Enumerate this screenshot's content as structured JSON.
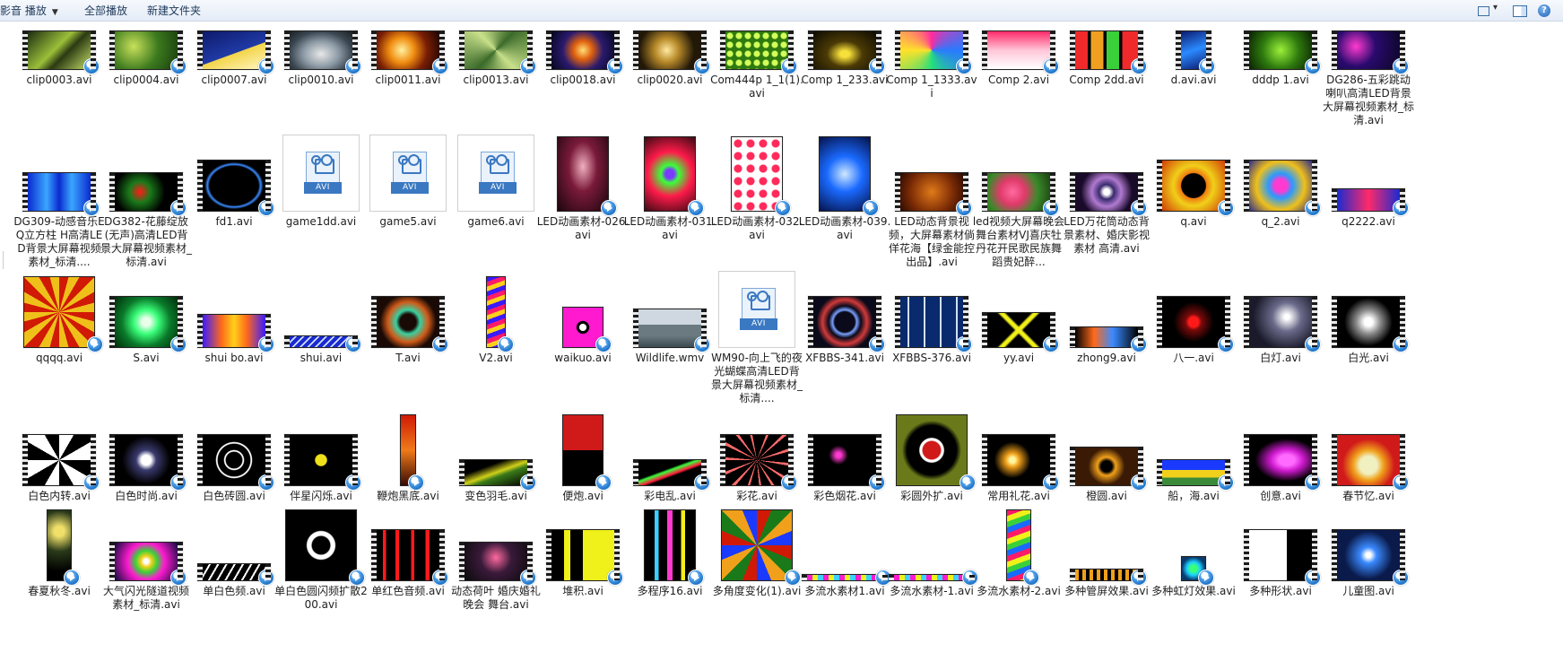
{
  "toolbar": {
    "play_label": "影音 播放",
    "play_all_label": "全部播放",
    "new_folder_label": "新建文件夹",
    "help_glyph": "?"
  },
  "colors": {
    "toolbar_text": "#1e395b",
    "badge": "#1e74c9"
  },
  "files": [
    {
      "name": "clip0003.avi",
      "kind": "film",
      "w": 70,
      "h": 44,
      "bg": "linear-gradient(135deg,#1a2a10,#9bbf3a 45%,#2b3a12 60%,#c7e06a)"
    },
    {
      "name": "clip0004.avi",
      "kind": "film",
      "w": 70,
      "h": 44,
      "bg": "radial-gradient(circle at 30% 40%,#c8e05a,#3c7a1e 50%,#183c0e)"
    },
    {
      "name": "clip0007.avi",
      "kind": "film",
      "w": 70,
      "h": 44,
      "bg": "linear-gradient(160deg,#0d1a6b,#203aa6 55%,#f3d54a 56%,#fff6c4)"
    },
    {
      "name": "clip0010.avi",
      "kind": "film",
      "w": 70,
      "h": 44,
      "bg": "radial-gradient(ellipse at 50% 60%,#e8e8e8,#8c9aa5 40%,#3a4650 70%,#1c1f22)"
    },
    {
      "name": "clip0011.avi",
      "kind": "film",
      "w": 70,
      "h": 44,
      "bg": "radial-gradient(circle at 40% 50%,#fff2a0,#f08c10 30%,#7a1e05 60%,#160400)"
    },
    {
      "name": "clip0013.avi",
      "kind": "film",
      "w": 70,
      "h": 44,
      "bg": "conic-gradient(from 45deg,#3b6a2a,#c8e08a,#3b6a2a,#c8e08a,#3b6a2a)"
    },
    {
      "name": "clip0018.avi",
      "kind": "film",
      "w": 70,
      "h": 44,
      "bg": "radial-gradient(circle at 50% 50%,#ffe07a,#e2620e 25%,#2a1a6e 55%,#05061c)"
    },
    {
      "name": "clip0020.avi",
      "kind": "film",
      "w": 70,
      "h": 44,
      "bg": "radial-gradient(circle at 45% 50%,#ffe9a0,#b88a2a 30%,#221808 70%)"
    },
    {
      "name": "Com444p 1_1(1).avi",
      "kind": "film",
      "w": 70,
      "h": 44,
      "bg": "radial-gradient(circle,#d4ff5a 0 3px,#2e7a0e 4px) 0 0/10px 10px"
    },
    {
      "name": "Comp 1_233.avi",
      "kind": "film",
      "w": 70,
      "h": 44,
      "bg": "radial-gradient(ellipse at 50% 60%,#f7e03a 0 10%,#4b3a05 40%,#0c0a02)"
    },
    {
      "name": "Comp 1_1333.avi",
      "kind": "film",
      "w": 70,
      "h": 44,
      "bg": "conic-gradient(#ff2aa0,#2a7aff,#24e07a,#ffe12a,#ff2aa0)"
    },
    {
      "name": "Comp 2.avi",
      "kind": "film",
      "w": 70,
      "h": 44,
      "bg": "linear-gradient(#ff2a6a,#ffc6d8 50%,#fff)"
    },
    {
      "name": "Comp 2dd.avi",
      "kind": "film",
      "w": 70,
      "h": 44,
      "bg": "linear-gradient(90deg,#f02a2a 0 20%,#000 20% 25%,#f0a020 25% 45%,#000 45% 50%,#39d03a 50% 70%,#000 70% 75%,#f02a2a 75%)"
    },
    {
      "name": "d.avi.avi",
      "kind": "film",
      "w": 28,
      "h": 44,
      "bg": "linear-gradient(160deg,#0b1a6e,#2a8aff 50%,#0b1a6e)"
    },
    {
      "name": "dddp 1.avi",
      "kind": "film",
      "w": 70,
      "h": 44,
      "bg": "radial-gradient(circle,#9cf03a,#2e7a0e 50%,#0a1f03)"
    },
    {
      "name": "DG286-五彩跳动喇叭高清LED背景大屏幕视频素材_标清.avi",
      "kind": "film",
      "w": 70,
      "h": 44,
      "bg": "radial-gradient(circle at 30% 40%,#ff3ad0,#2a0a6e 40%,#0a0622)"
    },
    {
      "name": "DG309-动感音乐EQ立方柱 H高清LED背景大屏幕视频素材_标清....",
      "kind": "film",
      "w": 70,
      "h": 44,
      "bg": "linear-gradient(90deg,#0a2ad0,#3aa6ff 30%,#0a2ad0 50%,#3aa6ff 70%,#0a2ad0)"
    },
    {
      "name": "DG382-花藤绽放(无声)高清LED背景大屏幕视频素材_标清.avi",
      "kind": "film",
      "w": 70,
      "h": 44,
      "bg": "radial-gradient(circle at 40% 50%,#ff1a1a,#1a7a1a 25%,#000 60%)"
    },
    {
      "name": "fd1.avi",
      "kind": "film",
      "w": 70,
      "h": 58,
      "bg": "radial-gradient(ellipse at 50% 50%,#000 55%,#3a8aff 60%,#000 66%)"
    },
    {
      "name": "game1dd.avi",
      "kind": "doc"
    },
    {
      "name": "game5.avi",
      "kind": "doc"
    },
    {
      "name": "game6.avi",
      "kind": "doc"
    },
    {
      "name": "LED动画素材-026.avi",
      "kind": "plain",
      "w": 58,
      "h": 84,
      "bg": "radial-gradient(ellipse at 50% 40%,#f0b0c0,#7a1a3a 40%,#1a050c)"
    },
    {
      "name": "LED动画素材-031.avi",
      "kind": "plain",
      "w": 58,
      "h": 84,
      "bg": "radial-gradient(circle,#7a3aff 0 10%,#3aff3a 20%,#ff1a4a 50%,#3a0a12)"
    },
    {
      "name": "LED动画素材-032.avi",
      "kind": "plain",
      "w": 58,
      "h": 84,
      "bg": "radial-gradient(circle,#ff2a5a 0 4px,#fff 5px) 0 0/14px 14px"
    },
    {
      "name": "LED动画素材-039.avi",
      "kind": "plain",
      "w": 58,
      "h": 84,
      "bg": "radial-gradient(circle at 50% 50%,#cfe8ff,#1a6aff 40%,#05124a)"
    },
    {
      "name": "LED动态背景视频，大屏幕素材倘佯花海【绿金能控出品】.avi",
      "kind": "film",
      "w": 70,
      "h": 44,
      "bg": "radial-gradient(circle,#e07a1a,#7a2a05 60%,#2a0a02)"
    },
    {
      "name": "led视频大屏幕晚会舞台素材VJ喜庆牡丹花开民歌民族舞蹈贵妃醉...",
      "kind": "film",
      "w": 70,
      "h": 44,
      "bg": "radial-gradient(circle at 40% 50%,#ff6aa0,#e03a6a 30%,#3a8a2a 60%,#1a3a10)"
    },
    {
      "name": "LED万花筒动态背景素材、婚庆影视素材 高清.avi",
      "kind": "film",
      "w": 70,
      "h": 44,
      "bg": "radial-gradient(circle,#fff 0 8%,#3a2a6e 20%,#b07ad0 40%,#1a0a2a 70%)"
    },
    {
      "name": "q.avi",
      "kind": "film",
      "w": 70,
      "h": 58,
      "bg": "radial-gradient(circle,#000 0 30%,#f07a10 32%,#f0d01a 50%,#d03a05)"
    },
    {
      "name": "q_2.avi",
      "kind": "film",
      "w": 70,
      "h": 58,
      "bg": "radial-gradient(circle,#ff3ad0 0 15%,#2a9aff 30%,#f0c01a 60%,#2a2a8a)"
    },
    {
      "name": "q2222.avi",
      "kind": "film",
      "w": 70,
      "h": 26,
      "bg": "linear-gradient(90deg,#1a2ad0,#ff2a6a 50%,#1a2ad0)"
    },
    {
      "name": "qqqq.avi",
      "kind": "plain",
      "w": 80,
      "h": 80,
      "bg": "repeating-conic-gradient(from 0deg,#d01a05 0 15deg,#f0c01a 15deg 30deg)"
    },
    {
      "name": "S.avi",
      "kind": "film",
      "w": 70,
      "h": 58,
      "bg": "radial-gradient(circle,#eaffea 0 10%,#3aff7a 30%,#0a7a2a 60%,#022a0a)"
    },
    {
      "name": "shui bo.avi",
      "kind": "film",
      "w": 70,
      "h": 38,
      "bg": "linear-gradient(90deg,#3a1aff,#ff6a1a 30%,#ffd01a 50%,#ff6a1a 70%,#3a1aff)"
    },
    {
      "name": "shui.avi",
      "kind": "film",
      "w": 70,
      "h": 14,
      "bg": "repeating-linear-gradient(135deg,#1a2ad0 0 4px,#cfe0ff 4px 6px)"
    },
    {
      "name": "T.avi",
      "kind": "film",
      "w": 70,
      "h": 58,
      "bg": "radial-gradient(circle,#1a0a05 0 20%,#3ad0a0 30%,#d05a1a 50%,#1a0a05 70%)"
    },
    {
      "name": "V2.avi",
      "kind": "plain",
      "w": 22,
      "h": 80,
      "bg": "repeating-linear-gradient(160deg,#3a1aff 0 5px,#ff1a6a 5px 10px,#ffd01a 10px 15px)"
    },
    {
      "name": "waikuo.avi",
      "kind": "plain",
      "w": 46,
      "h": 46,
      "bg": "radial-gradient(circle,#fff 0 12%,#000 14% 22%,#ff1ad0 24%)"
    },
    {
      "name": "Wildlife.wmv",
      "kind": "film",
      "w": 70,
      "h": 44,
      "bg": "linear-gradient(#cfd8e0 0 40%,#6a7a80 40% 70%,#3a4a50)"
    },
    {
      "name": "WM90-向上飞的夜光蝴蝶高清LED背景大屏幕视频素材_标清....",
      "kind": "doc"
    },
    {
      "name": "XFBBS-341.avi",
      "kind": "film",
      "w": 70,
      "h": 58,
      "bg": "radial-gradient(circle,#0a0a1a 0 25%,#7aa0ff 30%,#0a0a1a 40%,#d03a3a 55%,#0a0a1a 70%)"
    },
    {
      "name": "XFBBS-376.avi",
      "kind": "film",
      "w": 70,
      "h": 58,
      "bg": "repeating-linear-gradient(90deg,#0a2a6e 0 8px,#cfe0ff 8px 10px,#0a2a6e 10px 18px)"
    },
    {
      "name": "yy.avi",
      "kind": "film",
      "w": 70,
      "h": 40,
      "bg": "linear-gradient(45deg,transparent 45%,#f0f01a 48%,#f0f01a 52%,transparent 55%),linear-gradient(-45deg,#000 45%,#f0f01a 48%,#f0f01a 52%,#000 55%)"
    },
    {
      "name": "zhong9.avi",
      "kind": "film",
      "w": 70,
      "h": 24,
      "bg": "linear-gradient(90deg,#000,#ff6a1a 30%,#3a8aff 60%,#000)"
    },
    {
      "name": "八一.avi",
      "kind": "film",
      "w": 70,
      "h": 58,
      "bg": "radial-gradient(circle,#ff1a1a 0 12%,#7a0a0a 20%,#000 50%)"
    },
    {
      "name": "白灯.avi",
      "kind": "film",
      "w": 70,
      "h": 58,
      "bg": "radial-gradient(circle at 60% 40%,#fff 0 5%,#6a6a8a 30%,#1a1a2a 70%)"
    },
    {
      "name": "白光.avi",
      "kind": "film",
      "w": 70,
      "h": 58,
      "bg": "radial-gradient(circle,#fff 0 10%,#8a8a8a 30%,#000 60%)"
    },
    {
      "name": "白色内转.avi",
      "kind": "film",
      "w": 70,
      "h": 58,
      "bg": "repeating-conic-gradient(#fff 0 30deg,#000 30deg 60deg)"
    },
    {
      "name": "白色时尚.avi",
      "kind": "film",
      "w": 70,
      "h": 58,
      "bg": "radial-gradient(circle,#fff 0 12%,#3a3a6e 25%,#000 60%)"
    },
    {
      "name": "白色砖圆.avi",
      "kind": "film",
      "w": 70,
      "h": 58,
      "bg": "radial-gradient(circle,#000 0 20%,#fff 22% 24%,#000 26% 40%,#fff 42% 44%,#000 46%)"
    },
    {
      "name": "伴星闪烁.avi",
      "kind": "film",
      "w": 70,
      "h": 58,
      "bg": "radial-gradient(circle,#f0e01a 0 14%,#000 16%)"
    },
    {
      "name": "鞭炮黑底.avi",
      "kind": "plain",
      "w": 18,
      "h": 80,
      "bg": "linear-gradient(#d01a05,#f07a1a 50%,#3a0a02)"
    },
    {
      "name": "变色羽毛.avi",
      "kind": "film",
      "w": 70,
      "h": 30,
      "bg": "linear-gradient(160deg,#000 30%,#d0d01a 50%,#3a7a1a 60%,#000)"
    },
    {
      "name": "便炮.avi",
      "kind": "plain",
      "w": 46,
      "h": 80,
      "bg": "linear-gradient(#d01a1a 0 50%,#000 50%)"
    },
    {
      "name": "彩电乱.avi",
      "kind": "film",
      "w": 70,
      "h": 30,
      "bg": "linear-gradient(160deg,#000 40%,#3aff3a 45%,#ff1a3a 55%,#000 60%)"
    },
    {
      "name": "彩花.avi",
      "kind": "film",
      "w": 70,
      "h": 58,
      "bg": "repeating-conic-gradient(#000 0 20deg,#ff6a6a 20deg 25deg)"
    },
    {
      "name": "彩色烟花.avi",
      "kind": "film",
      "w": 70,
      "h": 58,
      "bg": "radial-gradient(circle at 40% 40%,#ff3ad0 0 5%,#000 20%),radial-gradient(circle at 60% 60%,#3aff3a 0 5%,#000 25%)"
    },
    {
      "name": "彩圆外扩.avi",
      "kind": "plain",
      "w": 80,
      "h": 80,
      "bg": "radial-gradient(circle,#d01a1a 0 18%,#fff 20% 24%,#000 26% 50%,#6a7a1a 60%)"
    },
    {
      "name": "常用礼花.avi",
      "kind": "film",
      "w": 70,
      "h": 58,
      "bg": "radial-gradient(circle at 40% 50%,#fff6a0 0 6%,#f0a01a 15%,#000 40%)"
    },
    {
      "name": "橙圆.avi",
      "kind": "film",
      "w": 70,
      "h": 44,
      "bg": "radial-gradient(circle,#000 0 15%,#f0a01a 25%,#3a1a05 50%)"
    },
    {
      "name": "船，海.avi",
      "kind": "film",
      "w": 70,
      "h": 30,
      "bg": "linear-gradient(#1a3aff 0 40%,#f0d01a 40% 70%,#3a8a3a 70%)"
    },
    {
      "name": "创意.avi",
      "kind": "film",
      "w": 70,
      "h": 58,
      "bg": "radial-gradient(ellipse at 60% 50%,#ff6aff 0 15%,#d01ad0 30%,#000 60%)"
    },
    {
      "name": "春节忆.avi",
      "kind": "film",
      "w": 70,
      "h": 58,
      "bg": "radial-gradient(circle at 50% 60%,#f0f0c0 0 20%,#f0a01a 35%,#d01a1a 60%)"
    },
    {
      "name": "春夏秋冬.avi",
      "kind": "plain",
      "w": 28,
      "h": 80,
      "bg": "radial-gradient(circle at 50% 30%,#f0e06a 0 10%,#2a3a1a 40%,#000 80%)"
    },
    {
      "name": "大气闪光隧道视频素材_标清.avi",
      "kind": "film",
      "w": 70,
      "h": 44,
      "bg": "radial-gradient(circle,#fff 0 6%,#f0d01a 15%,#3ad03a 30%,#ff1ad0 50%,#0a0a3a)"
    },
    {
      "name": "单白色频.avi",
      "kind": "film",
      "w": 70,
      "h": 20,
      "bg": "repeating-linear-gradient(120deg,#000 0 6px,#fff 6px 8px)"
    },
    {
      "name": "单白色圆闪频扩散200.avi",
      "kind": "plain",
      "w": 80,
      "h": 80,
      "bg": "radial-gradient(circle,#000 0 18%,#fff 20% 28%,#000 30%)"
    },
    {
      "name": "单红色音频.avi",
      "kind": "film",
      "w": 70,
      "h": 58,
      "bg": "linear-gradient(90deg,#000 0 10%,#ff1a1a 10% 15%,#000 15% 30%,#ff1a1a 30% 36%,#000 36% 55%,#ff1a1a 55% 60%,#000 60% 78%,#ff1a1a 78% 84%,#000 84%)"
    },
    {
      "name": "动态荷叶 婚庆婚礼 晚会 舞台.avi",
      "kind": "film",
      "w": 70,
      "h": 44,
      "bg": "radial-gradient(circle at 50% 40%,#ff6aa0,#3a1a3a 40%,#0a0a0a)"
    },
    {
      "name": "堆积.avi",
      "kind": "film",
      "w": 70,
      "h": 58,
      "bg": "linear-gradient(90deg,#000 0 20%,#f0f01a 20% 30%,#000 30% 50%,#f0f01a 50%)"
    },
    {
      "name": "多程序16.avi",
      "kind": "plain",
      "w": 58,
      "h": 80,
      "bg": "linear-gradient(90deg,#000 0 20%,#3ad0ff 20% 28%,#000 28% 45%,#ff3ad0 45% 55%,#000 55% 72%,#f0f01a 72% 80%,#000 80%)"
    },
    {
      "name": "多角度变化(1).avi",
      "kind": "plain",
      "w": 80,
      "h": 80,
      "bg": "repeating-conic-gradient(#d01a05 0 22.5deg,#1a7a1a 22.5deg 45deg,#f0a01a 45deg 67.5deg,#1a3aff 67.5deg 90deg)"
    },
    {
      "name": "多流水素材1.avi",
      "kind": "film",
      "w": 84,
      "h": 8,
      "bg": "repeating-linear-gradient(90deg,#ff1ad0 0 6px,#f0f01a 6px 12px,#3ad0ff 12px 18px)"
    },
    {
      "name": "多流水素材-1.avi",
      "kind": "film",
      "w": 84,
      "h": 8,
      "bg": "repeating-linear-gradient(90deg,#ff1ad0 0 6px,#f0f01a 6px 12px,#3ad0ff 12px 18px)"
    },
    {
      "name": "多流水素材-2.avi",
      "kind": "plain",
      "w": 28,
      "h": 80,
      "bg": "repeating-linear-gradient(160deg,#ff1a6a 0 6px,#f0f01a 6px 12px,#3ad03a 12px 18px,#1a6aff 18px 24px)"
    },
    {
      "name": "多种管屏效果.avi",
      "kind": "film",
      "w": 70,
      "h": 14,
      "bg": "repeating-linear-gradient(90deg,#f0a01a 0 4px,#000 4px 8px)"
    },
    {
      "name": "多种虹灯效果.avi",
      "kind": "plain",
      "w": 28,
      "h": 28,
      "bg": "radial-gradient(circle,#3aff7a 0 20%,#1ad0ff 40%,#0a3a6e 70%)"
    },
    {
      "name": "多种形状.avi",
      "kind": "film",
      "w": 70,
      "h": 58,
      "bg": "linear-gradient(90deg,#fff 0 60%,#000 60%)"
    },
    {
      "name": "儿童图.avi",
      "kind": "film",
      "w": 70,
      "h": 58,
      "bg": "radial-gradient(circle at 50% 50%,#fff 0 6%,#3a8aff 20%,#0a1a4a 60%)"
    }
  ]
}
